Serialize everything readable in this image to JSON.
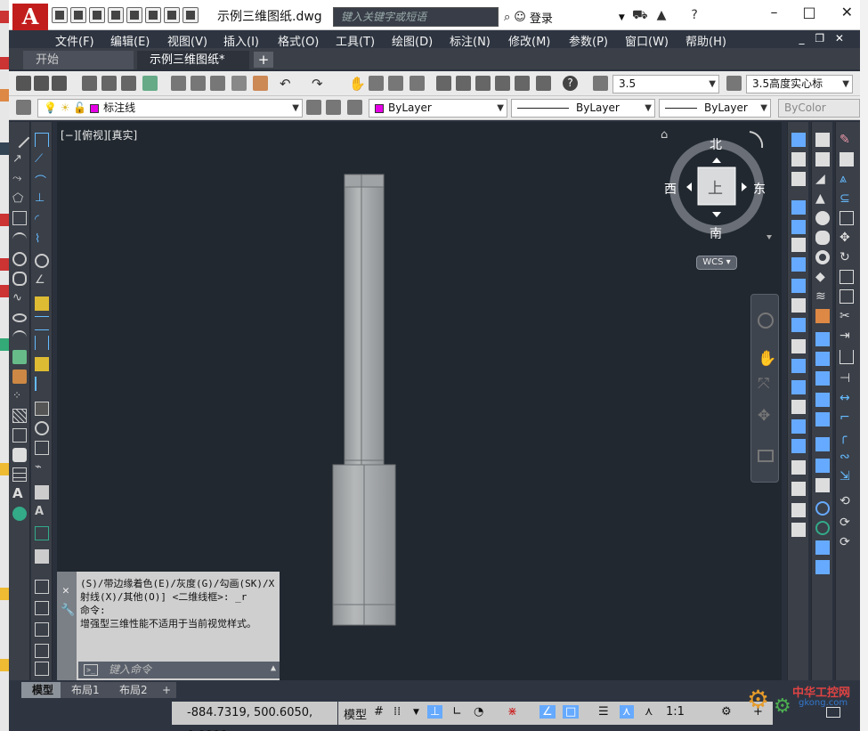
{
  "app": {
    "logo": "A",
    "drawing_title": "示例三维图纸.dwg"
  },
  "search": {
    "placeholder": "键入关键字或短语"
  },
  "account": {
    "login_label": "登录"
  },
  "menu": [
    "文件(F)",
    "编辑(E)",
    "视图(V)",
    "插入(I)",
    "格式(O)",
    "工具(T)",
    "绘图(D)",
    "标注(N)",
    "修改(M)",
    "参数(P)",
    "窗口(W)",
    "帮助(H)"
  ],
  "tabs": {
    "start": "开始",
    "active": "示例三维图纸*",
    "close_glyph": "×",
    "add_glyph": "+"
  },
  "toolbar": {
    "text_height": "3.5",
    "dim_style": "3.5高度实心标"
  },
  "properties": {
    "layer": "标注线",
    "color": "ByLayer",
    "linetype": "ByLayer",
    "lineweight": "ByLayer",
    "plotstyle": "ByColor"
  },
  "viewport": {
    "label": "[−][俯视][真实]"
  },
  "viewcube": {
    "north": "北",
    "south": "南",
    "east": "东",
    "west": "西",
    "face": "上",
    "ucs": "WCS"
  },
  "command": {
    "history": "(S)/带边缘着色(E)/灰度(G)/勾画(SK)/X 射线(X)/其他(O)] <二维线框>: _r\n命令:\n增强型三维性能不适用于当前视觉样式。",
    "placeholder": "键入命令"
  },
  "layouts": {
    "model": "模型",
    "layout1": "布局1",
    "layout2": "布局2",
    "add": "+"
  },
  "statusbar": {
    "coordinates": "-884.7319, 500.6050, 0.0000",
    "model_label": "模型",
    "scale": "1:1"
  },
  "watermark": {
    "name": "中华工控网",
    "url": "gkong.com"
  },
  "colors": {
    "bylayer_swatch": "#e600e6",
    "viewport_bg": "#212830",
    "accent": "#c21d1d"
  }
}
